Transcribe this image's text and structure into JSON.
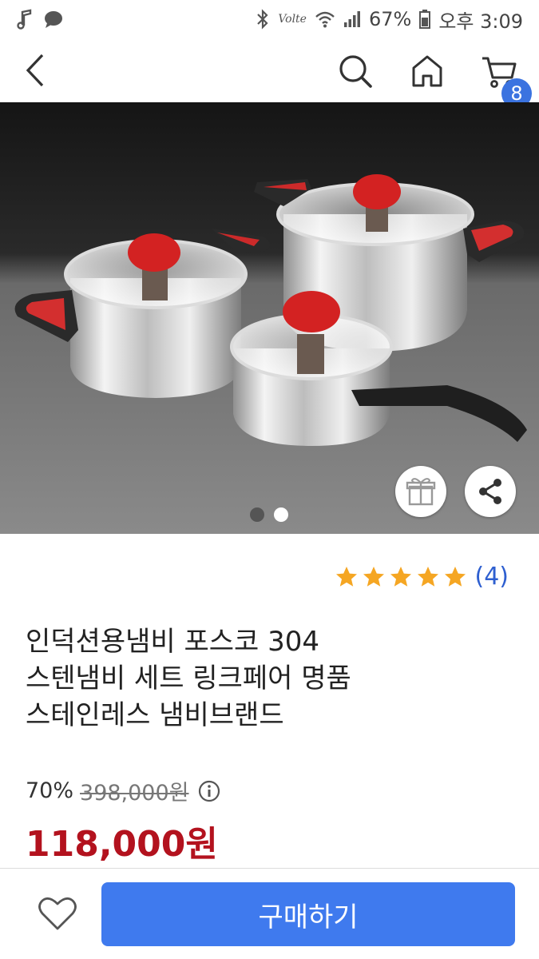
{
  "status_bar": {
    "left_icons": [
      "music-note-icon",
      "chat-bubble-icon"
    ],
    "right_icons": [
      "bluetooth-icon",
      "volte-icon",
      "wifi-icon",
      "signal-icon"
    ],
    "volte_label": "Volte",
    "battery": "67%",
    "time": "오후 3:09"
  },
  "app_bar": {
    "icons": [
      "back-icon",
      "search-icon",
      "home-icon",
      "cart-icon"
    ],
    "cart_count": "8"
  },
  "product_image": {
    "image_count": 2,
    "active_index": 1,
    "buttons": [
      "gift-icon",
      "share-icon"
    ]
  },
  "rating": {
    "stars": 5,
    "max_stars": 5,
    "count_label": "(4)",
    "star_color": "#f5a623"
  },
  "product": {
    "title_lines": [
      "인덕션용냄비 포스코 304",
      "스텐냄비 세트 링크페어 명품",
      "스테인레스 냄비브랜드"
    ],
    "discount": "70%",
    "original_price": "398,000원",
    "sale_price": "118,000원",
    "price_color": "#b3121e"
  },
  "bottom_bar": {
    "wishlist_icon": "heart-icon",
    "buy_label": "구매하기",
    "buy_color": "#3f7aee"
  }
}
